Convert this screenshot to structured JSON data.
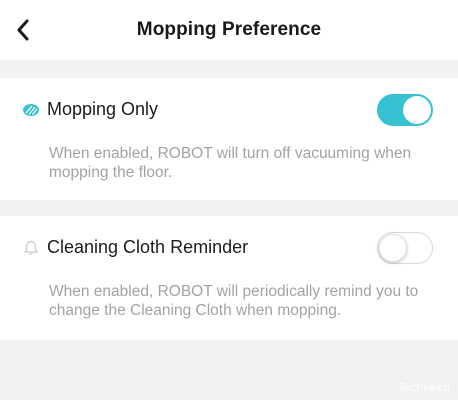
{
  "header": {
    "title": "Mopping Preference",
    "back_icon": "chevron-left-icon"
  },
  "settings": [
    {
      "label": "Mopping Only",
      "icon": "mop-icon",
      "icon_color": "#37c2d2",
      "enabled": true,
      "description": "When enabled, ROBOT will turn off vacuuming when mopping the floor."
    },
    {
      "label": "Cleaning Cloth Reminder",
      "icon": "bell-icon",
      "icon_color": "#c9c9cc",
      "enabled": false,
      "description": "When enabled, ROBOT will periodically remind you to change the Cleaning Cloth when mopping."
    }
  ],
  "colors": {
    "accent": "#37c2d2",
    "background": "#f2f2f4"
  },
  "watermark": "Techveen"
}
